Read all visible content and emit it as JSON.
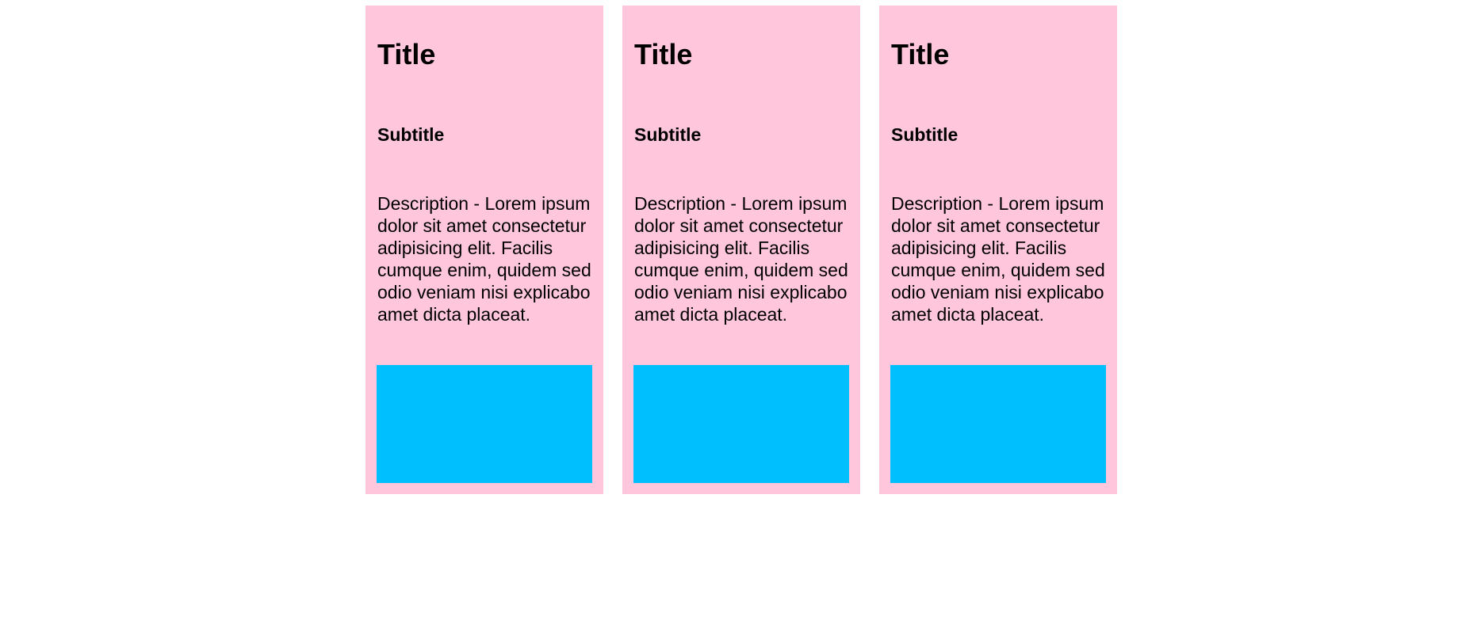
{
  "colors": {
    "card_background": "#FFC6DC",
    "image_placeholder": "#00BFFF",
    "page_background": "#FFFFFF"
  },
  "cards": [
    {
      "title": "Title",
      "subtitle": "Subtitle",
      "description": "Description - Lorem ipsum dolor sit amet consectetur adipisicing elit. Facilis cumque enim, quidem sed odio veniam nisi explicabo amet dicta placeat."
    },
    {
      "title": "Title",
      "subtitle": "Subtitle",
      "description": "Description - Lorem ipsum dolor sit amet consectetur adipisicing elit. Facilis cumque enim, quidem sed odio veniam nisi explicabo amet dicta placeat."
    },
    {
      "title": "Title",
      "subtitle": "Subtitle",
      "description": "Description - Lorem ipsum dolor sit amet consectetur adipisicing elit. Facilis cumque enim, quidem sed odio veniam nisi explicabo amet dicta placeat."
    }
  ]
}
